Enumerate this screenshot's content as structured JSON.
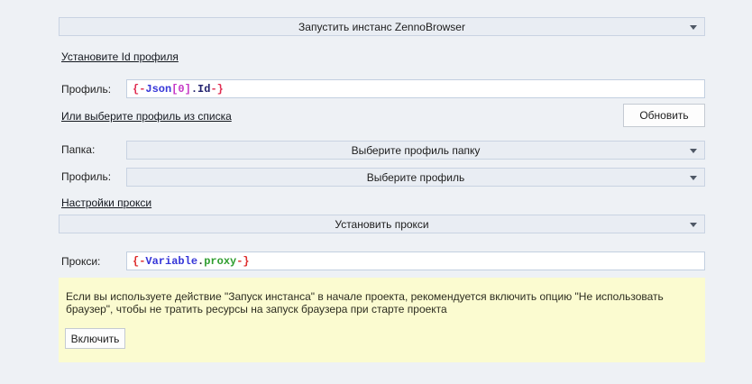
{
  "colors": {
    "page_bg": "#eef1f5",
    "combo_bg": "#e9edf3",
    "combo_border": "#c9d3e2",
    "note_bg": "#fbfbd0"
  },
  "action_combo": {
    "value": "Запустить инстанс ZennoBrowser"
  },
  "profile_id": {
    "heading": "Установите Id профиля",
    "label": "Профиль:",
    "value_segments": [
      {
        "text": "{-",
        "color": "#e02b50"
      },
      {
        "text": "Json",
        "color": "#3636d8"
      },
      {
        "text": "[0]",
        "color": "#c536c5"
      },
      {
        "text": ".Id",
        "color": "#22226e"
      },
      {
        "text": "-}",
        "color": "#e02b50"
      }
    ]
  },
  "profile_list": {
    "heading": "Или выберите профиль из списка",
    "refresh_button": "Обновить",
    "folder_label": "Папка:",
    "folder_value": "Выберите профиль папку",
    "profile_label": "Профиль:",
    "profile_value": "Выберите профиль"
  },
  "proxy": {
    "heading": "Настройки прокси",
    "mode_value": "Установить прокси",
    "label": "Прокси:",
    "value_segments": [
      {
        "text": "{-",
        "color": "#dd2c2c"
      },
      {
        "text": "Variable",
        "color": "#3636d8"
      },
      {
        "text": ".",
        "color": "#333333"
      },
      {
        "text": "proxy",
        "color": "#2f9e2f"
      },
      {
        "text": "-}",
        "color": "#dd2c2c"
      }
    ]
  },
  "note": {
    "text": "Если вы используете действие \"Запуск инстанса\" в начале проекта, рекомендуется включить опцию \"Не использовать браузер\", чтобы не тратить ресурсы на запуск браузера при старте проекта",
    "enable_button": "Включить"
  }
}
